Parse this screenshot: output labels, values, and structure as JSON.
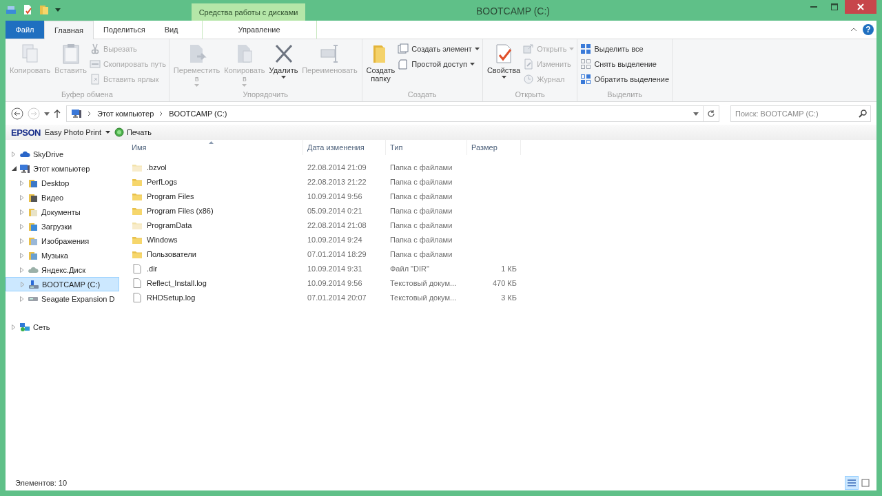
{
  "window": {
    "title": "BOOTCAMP (C:)",
    "context_group": "Средства работы с дисками"
  },
  "ribbon_tabs": [
    {
      "label": "Файл",
      "kind": "file",
      "selected": false
    },
    {
      "label": "Главная",
      "kind": "normal",
      "selected": true
    },
    {
      "label": "Поделиться",
      "kind": "normal",
      "selected": false
    },
    {
      "label": "Вид",
      "kind": "normal",
      "selected": false
    },
    {
      "label": "Управление",
      "kind": "context",
      "selected": false
    }
  ],
  "help_button": "?",
  "ribbon_groups": [
    {
      "label": "Буфер обмена",
      "items": [
        {
          "kind": "large",
          "label": "Копировать",
          "disabled": true,
          "dropdown": false
        },
        {
          "kind": "large",
          "label": "Вставить",
          "disabled": true,
          "dropdown": false
        },
        {
          "kind": "small",
          "label": "Вырезать",
          "disabled": true,
          "dropdown": false
        },
        {
          "kind": "small",
          "label": "Скопировать путь",
          "disabled": true,
          "dropdown": false
        },
        {
          "kind": "small",
          "label": "Вставить ярлык",
          "disabled": true,
          "dropdown": false
        }
      ]
    },
    {
      "label": "Упорядочить",
      "items": [
        {
          "kind": "large",
          "label": "Переместить в",
          "disabled": true,
          "dropdown": true
        },
        {
          "kind": "large",
          "label": "Копировать в",
          "disabled": true,
          "dropdown": true
        },
        {
          "kind": "large",
          "label": "Удалить",
          "disabled": false,
          "dropdown": true
        },
        {
          "kind": "large",
          "label": "Переименовать",
          "disabled": true,
          "dropdown": false
        }
      ]
    },
    {
      "label": "Создать",
      "items": [
        {
          "kind": "large",
          "label": "Создать папку",
          "disabled": false,
          "dropdown": false
        },
        {
          "kind": "small",
          "label": "Создать элемент",
          "disabled": false,
          "dropdown": true
        },
        {
          "kind": "small",
          "label": "Простой доступ",
          "disabled": false,
          "dropdown": true
        }
      ]
    },
    {
      "label": "Открыть",
      "items": [
        {
          "kind": "large",
          "label": "Свойства",
          "disabled": false,
          "dropdown": true
        },
        {
          "kind": "small",
          "label": "Открыть",
          "disabled": true,
          "dropdown": true
        },
        {
          "kind": "small",
          "label": "Изменить",
          "disabled": true,
          "dropdown": false
        },
        {
          "kind": "small",
          "label": "Журнал",
          "disabled": true,
          "dropdown": false
        }
      ]
    },
    {
      "label": "Выделить",
      "items": [
        {
          "kind": "small",
          "label": "Выделить все",
          "disabled": false,
          "dropdown": false
        },
        {
          "kind": "small",
          "label": "Снять выделение",
          "disabled": false,
          "dropdown": false
        },
        {
          "kind": "small",
          "label": "Обратить выделение",
          "disabled": false,
          "dropdown": false
        }
      ]
    }
  ],
  "address_bar": {
    "breadcrumbs": [
      "Этот компьютер",
      "BOOTCAMP (C:)"
    ],
    "search_placeholder": "Поиск: BOOTCAMP (C:)"
  },
  "epson_toolbar": {
    "brand": "EPSON",
    "app": "Easy Photo Print",
    "print": "Печать"
  },
  "navigation": [
    {
      "label": "SkyDrive",
      "expanded": false,
      "selected": false
    },
    {
      "label": "Этот компьютер",
      "expanded": true,
      "selected": false,
      "children": [
        {
          "label": "Desktop",
          "expanded": false,
          "selected": false
        },
        {
          "label": "Видео",
          "expanded": false,
          "selected": false
        },
        {
          "label": "Документы",
          "expanded": false,
          "selected": false
        },
        {
          "label": "Загрузки",
          "expanded": false,
          "selected": false
        },
        {
          "label": "Изображения",
          "expanded": false,
          "selected": false
        },
        {
          "label": "Музыка",
          "expanded": false,
          "selected": false
        },
        {
          "label": "Яндекс.Диск",
          "expanded": false,
          "selected": false
        },
        {
          "label": "BOOTCAMP (C:)",
          "expanded": false,
          "selected": true
        },
        {
          "label": "Seagate Expansion D",
          "expanded": false,
          "selected": false
        }
      ]
    },
    {
      "label": "Сеть",
      "expanded": false,
      "selected": false
    }
  ],
  "file_list": {
    "columns": [
      "Имя",
      "Дата изменения",
      "Тип",
      "Размер"
    ],
    "rows": [
      {
        "kind": "folder",
        "hidden": true,
        "name": ".bzvol",
        "date": "22.08.2014 21:09",
        "type": "Папка с файлами"
      },
      {
        "kind": "folder",
        "hidden": false,
        "name": "PerfLogs",
        "date": "22.08.2013 21:22",
        "type": "Папка с файлами"
      },
      {
        "kind": "folder",
        "hidden": false,
        "name": "Program Files",
        "date": "10.09.2014 9:56",
        "type": "Папка с файлами"
      },
      {
        "kind": "folder",
        "hidden": false,
        "name": "Program Files (x86)",
        "date": "05.09.2014 0:21",
        "type": "Папка с файлами"
      },
      {
        "kind": "folder",
        "hidden": true,
        "name": "ProgramData",
        "date": "22.08.2014 21:08",
        "type": "Папка с файлами"
      },
      {
        "kind": "folder",
        "hidden": false,
        "name": "Windows",
        "date": "10.09.2014 9:24",
        "type": "Папка с файлами"
      },
      {
        "kind": "folder",
        "hidden": false,
        "name": "Пользователи",
        "date": "07.01.2014 18:29",
        "type": "Папка с файлами"
      },
      {
        "kind": "file",
        "hidden": false,
        "name": ".dir",
        "date": "10.09.2014 9:31",
        "type": "Файл \"DIR\"",
        "size": "1 КБ"
      },
      {
        "kind": "file",
        "hidden": false,
        "name": "Reflect_Install.log",
        "date": "10.09.2014 9:56",
        "type": "Текстовый докум...",
        "size": "470 КБ"
      },
      {
        "kind": "file",
        "hidden": false,
        "name": "RHDSetup.log",
        "date": "07.01.2014 20:07",
        "type": "Текстовый докум...",
        "size": "3 КБ"
      }
    ]
  },
  "status_bar": {
    "text": "Элементов: 10",
    "views": [
      {
        "selected": true
      },
      {
        "selected": false
      }
    ]
  }
}
